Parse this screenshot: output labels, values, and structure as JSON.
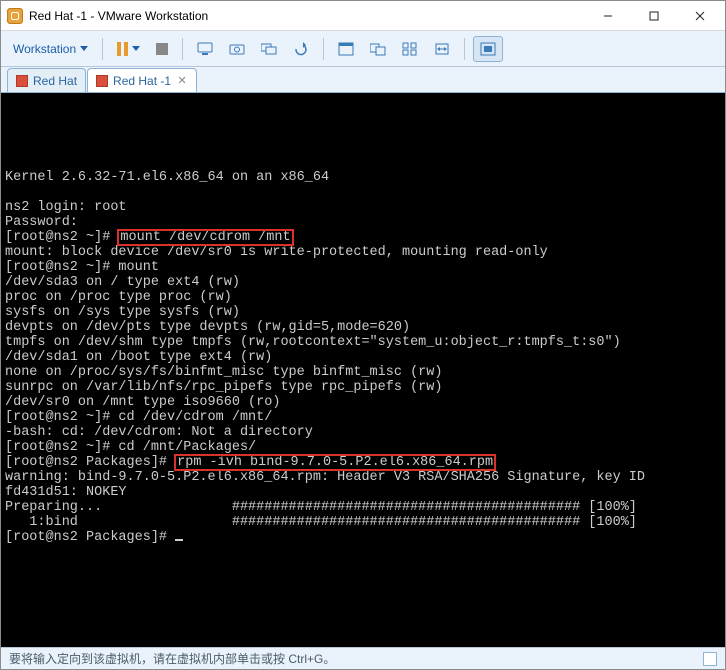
{
  "window": {
    "title": "Red Hat -1 - VMware Workstation"
  },
  "toolbar": {
    "menu_label": "Workstation"
  },
  "tabs": [
    {
      "label": "Red Hat",
      "active": false
    },
    {
      "label": "Red Hat -1",
      "active": true
    }
  ],
  "terminal": {
    "pre_gap": "\n\n\n\n",
    "line_kernel": "Kernel 2.6.32-71.el6.x86_64 on an x86_64",
    "line_blank": "",
    "line_login": "ns2 login: root",
    "line_password": "Password:",
    "line_p1_a": "[root@ns2 ~]# ",
    "line_p1_b": "mount /dev/cdrom /mnt",
    "line_mountmsg": "mount: block device /dev/sr0 is write-protected, mounting read-only",
    "line_p2": "[root@ns2 ~]# mount",
    "line_m1": "/dev/sda3 on / type ext4 (rw)",
    "line_m2": "proc on /proc type proc (rw)",
    "line_m3": "sysfs on /sys type sysfs (rw)",
    "line_m4": "devpts on /dev/pts type devpts (rw,gid=5,mode=620)",
    "line_m5": "tmpfs on /dev/shm type tmpfs (rw,rootcontext=\"system_u:object_r:tmpfs_t:s0\")",
    "line_m6": "/dev/sda1 on /boot type ext4 (rw)",
    "line_m7": "none on /proc/sys/fs/binfmt_misc type binfmt_misc (rw)",
    "line_m8": "sunrpc on /var/lib/nfs/rpc_pipefs type rpc_pipefs (rw)",
    "line_m9": "/dev/sr0 on /mnt type iso9660 (ro)",
    "line_p3": "[root@ns2 ~]# cd /dev/cdrom /mnt/",
    "line_cd_err": "-bash: cd: /dev/cdrom: Not a directory",
    "line_p4": "[root@ns2 ~]# cd /mnt/Packages/",
    "line_p5_a": "[root@ns2 Packages]# ",
    "line_p5_b": "rpm -ivh bind-9.7.0-5.P2.el6.x86_64.rpm",
    "line_warn": "warning: bind-9.7.0-5.P2.el6.x86_64.rpm: Header V3 RSA/SHA256 Signature, key ID",
    "line_warn2": "fd431d51: NOKEY",
    "line_prep": "Preparing...                ########################################### [100%]",
    "line_bind": "   1:bind                   ########################################### [100%]",
    "line_final": "[root@ns2 Packages]# "
  },
  "statusbar": {
    "text": "要将输入定向到该虚拟机，请在虚拟机内部单击或按 Ctrl+G。"
  }
}
